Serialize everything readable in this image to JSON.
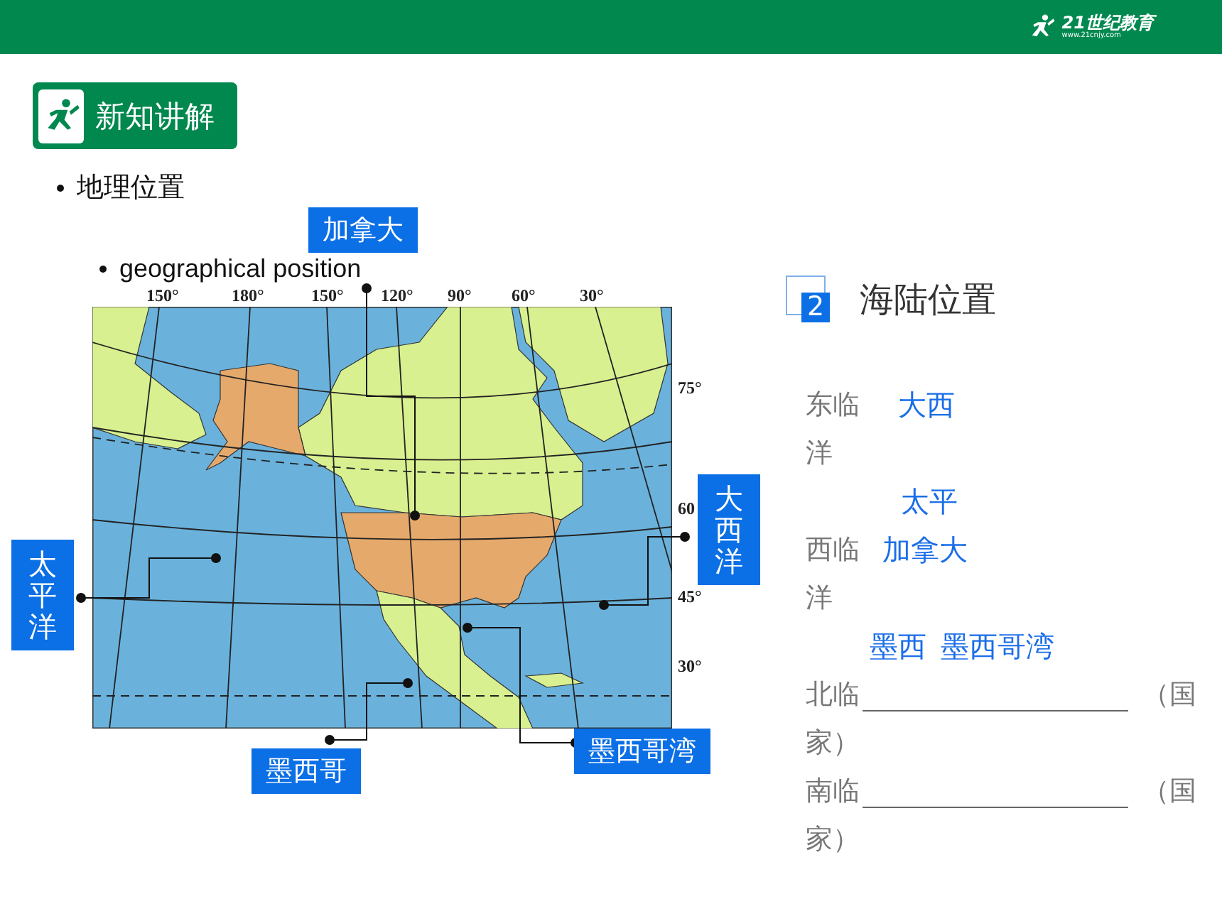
{
  "header": {
    "logo_text": "21世纪教育",
    "logo_url": "www.21cnjy.com"
  },
  "section_badge": {
    "title": "新知讲解"
  },
  "bullets": [
    {
      "text": "地理位置",
      "children": [
        {
          "text": "geographical position"
        }
      ]
    }
  ],
  "map": {
    "top_degrees": [
      "150°",
      "180°",
      "150°",
      "120°",
      "90°",
      "60°",
      "30°"
    ],
    "right_degrees": [
      "75°",
      "60",
      "45°",
      "30°"
    ],
    "callouts": [
      {
        "kind": "horizontal",
        "text": "加拿大"
      },
      {
        "kind": "vertical",
        "text": "太平洋"
      },
      {
        "kind": "vertical",
        "text": "大西洋"
      },
      {
        "kind": "horizontal",
        "text": "墨西哥"
      },
      {
        "kind": "horizontal",
        "text": "墨西哥湾"
      }
    ]
  },
  "panel": {
    "heading": {
      "number": "2",
      "title": "海陆位置"
    },
    "rows": [
      {
        "kind": "pair",
        "label": "东临",
        "answers": [
          "大西"
        ]
      },
      {
        "kind": "text",
        "label": "洋"
      },
      {
        "kind": "answer",
        "answers": [
          "太平"
        ]
      },
      {
        "kind": "pair",
        "label": "西临",
        "answers": [
          "加拿大"
        ]
      },
      {
        "kind": "text",
        "label": "洋"
      },
      {
        "kind": "answer",
        "answers": [
          "墨西",
          "墨西哥湾"
        ]
      },
      {
        "kind": "blank",
        "label": "北临",
        "suffix": "（国"
      },
      {
        "kind": "text",
        "label": "家）"
      },
      {
        "kind": "blank",
        "label": "南临",
        "suffix": "（国"
      },
      {
        "kind": "text",
        "label": "家）"
      }
    ]
  }
}
